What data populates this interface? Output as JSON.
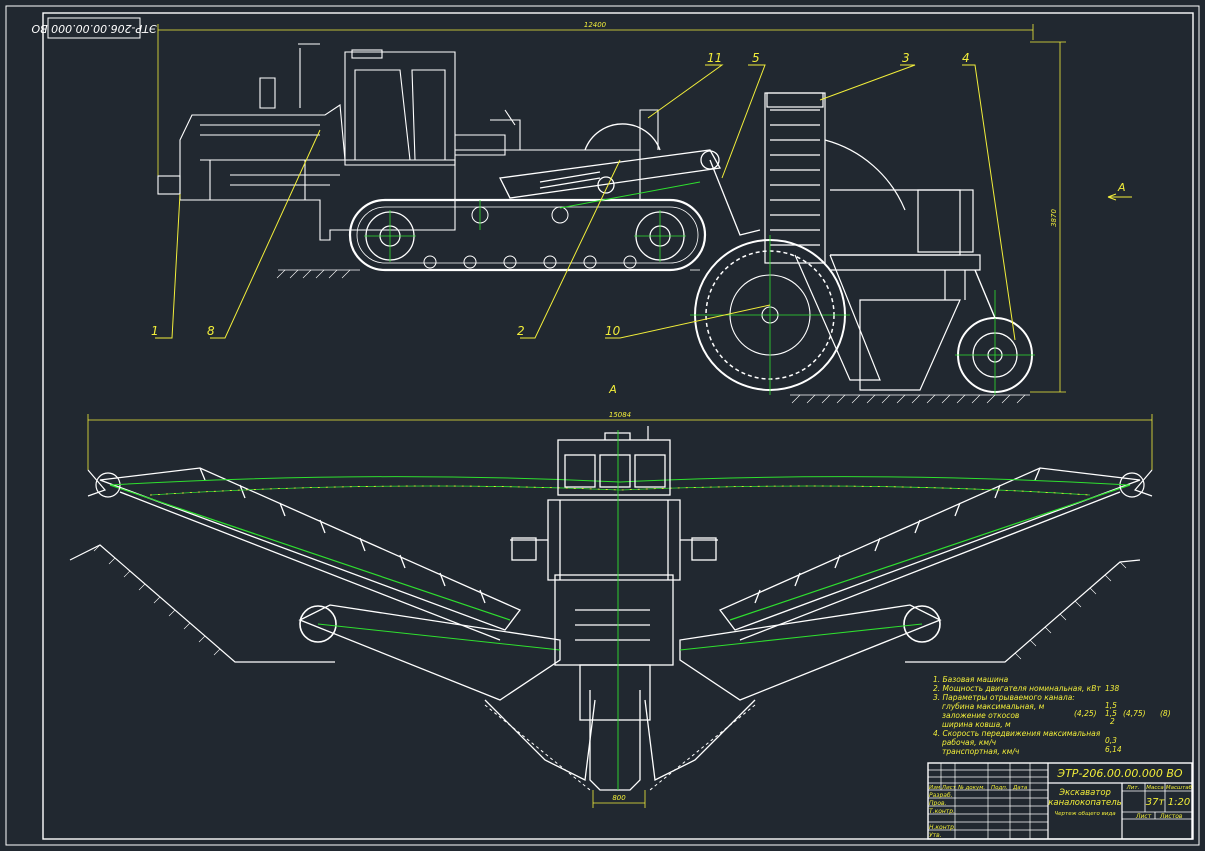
{
  "drawing": {
    "stamp_code": "ЭТР-206.00.00.000 ВО",
    "title_code": "ЭТР-206.00.00.000 ВО",
    "name_line1": "Экскаватор",
    "name_line2": "каналокопатель",
    "subtitle": "Чертеж общего вида",
    "scale_mass": "37т",
    "scale": "1:20",
    "col_lit": "Лит.",
    "col_mass": "Масса",
    "col_scale": "Масштаб",
    "sheet_label": "Лист",
    "sheets_label": "Листов",
    "stamp_rows": [
      "Изм.Лист",
      "Разраб.",
      "Пров.",
      "Т.контр.",
      "",
      "Н.контр.",
      "Утв."
    ],
    "stamp_cols": [
      "№ докум.",
      "Подп.",
      "Дата"
    ]
  },
  "dimensions": {
    "overall_length": "12400",
    "height": "3870",
    "width_plan": "15084",
    "bottom_width": "800"
  },
  "view_labels": {
    "section_a_side": "A",
    "section_a_title": "A"
  },
  "callouts": [
    "1",
    "8",
    "2",
    "10",
    "11",
    "5",
    "3",
    "4"
  ],
  "specs": {
    "items": [
      "1. Базовая машина",
      "2. Мощность двигателя номинальная, кВт",
      "3. Параметры отрываемого канала:",
      "глубина максимальная, м",
      "заложение откосов",
      "ширина ковша, м",
      "4. Скорость передвижения максимальная",
      "рабочая, км/ч",
      "транспортная, км/ч"
    ],
    "values": {
      "power": "138",
      "depth": "1,5",
      "slope_a": "1,5",
      "slope_b": "2",
      "bucket_a": "(4,25)",
      "bucket_b": "(4,75)",
      "bucket_c": "(8)",
      "speed_work": "0,3",
      "speed_transport": "6,14"
    }
  }
}
